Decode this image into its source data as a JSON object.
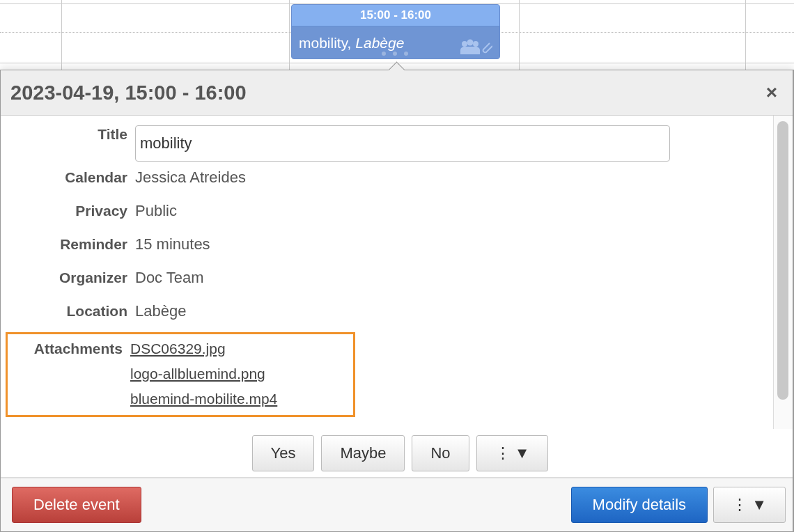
{
  "calendar_event": {
    "time": "15:00 - 16:00",
    "text": "mobility, *Labège*"
  },
  "dialog": {
    "title": "2023-04-19, 15:00 - 16:00",
    "close": "×"
  },
  "fields": [
    {
      "kind": "input",
      "label": "Title",
      "value": "mobility"
    },
    {
      "kind": "text",
      "label": "Calendar",
      "value": "Jessica Atreides"
    },
    {
      "kind": "text",
      "label": "Privacy",
      "value": "Public"
    },
    {
      "kind": "text",
      "label": "Reminder",
      "value": "15 minutes"
    },
    {
      "kind": "text",
      "label": "Organizer",
      "value": "Doc Team"
    },
    {
      "kind": "text",
      "label": "Location",
      "value": "Labège"
    },
    {
      "kind": "links",
      "label": "Attachments",
      "highlighted": true,
      "links": [
        "DSC06329.jpg",
        "logo-allbluemind.png",
        "bluemind-mobilite.mp4"
      ]
    }
  ],
  "response_buttons": [
    "Yes",
    "Maybe",
    "No",
    "⋮ ▼"
  ],
  "footer": {
    "delete": "Delete event",
    "modify": "Modify details",
    "more": "⋮ ▼"
  }
}
